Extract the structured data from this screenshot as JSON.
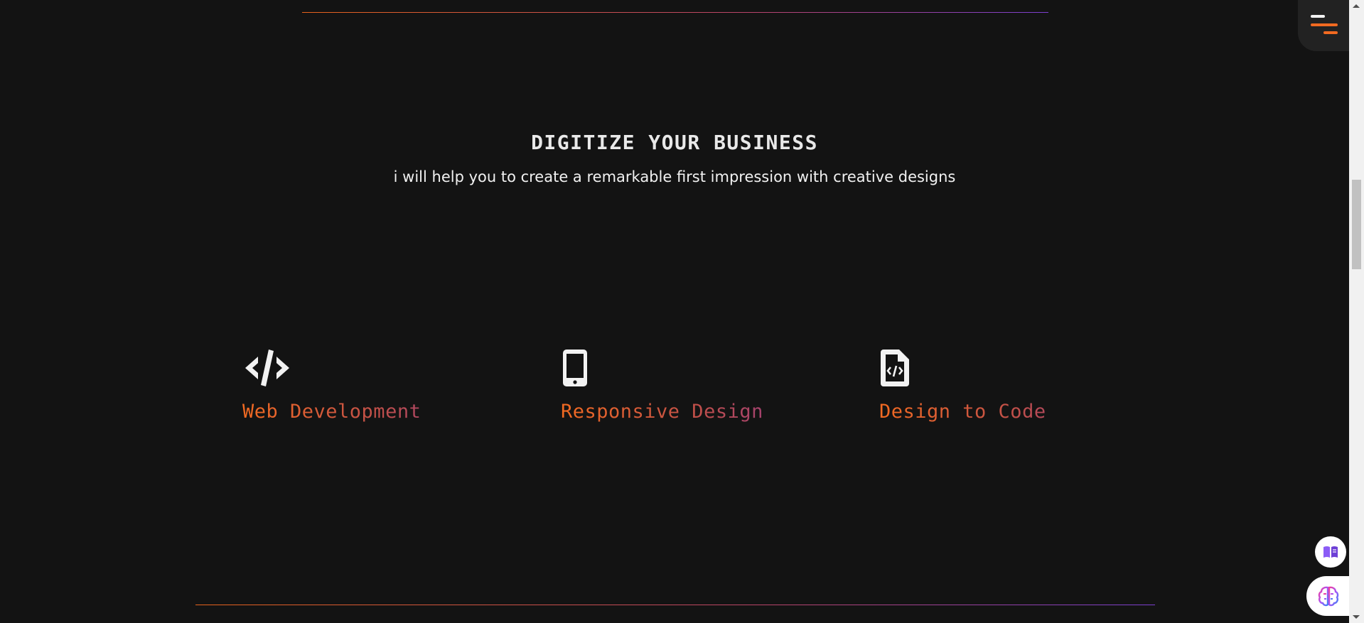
{
  "colors": {
    "background": "#131313",
    "accent_orange": "#f26a21",
    "accent_purple": "#7b3fd0",
    "heading": "#e9e9e9"
  },
  "menu": {
    "icon": "hamburger-menu-icon"
  },
  "section": {
    "title": "DIGITIZE YOUR BUSINESS",
    "subtitle": "i will help you to create a remarkable first impression with creative designs"
  },
  "services": [
    {
      "label": "Web Development",
      "icon": "code-icon"
    },
    {
      "label": "Responsive Design",
      "icon": "mobile-phone-icon"
    },
    {
      "label": "Design to Code",
      "icon": "code-file-icon"
    }
  ],
  "floating_buttons": [
    {
      "icon": "book-reader-icon"
    },
    {
      "icon": "brain-icon"
    }
  ]
}
